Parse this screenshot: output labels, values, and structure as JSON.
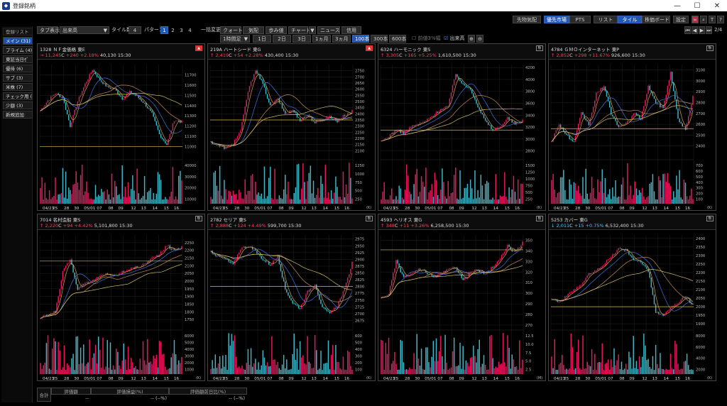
{
  "window": {
    "title": "登録銘柄",
    "minimize": "—",
    "maximize": "☐",
    "close": "✕"
  },
  "toolbar_top": {
    "pref_quote": "先物気配",
    "market": "優先市場",
    "pts": "PTS",
    "list": "リスト",
    "tile": "タイル",
    "board": "株価ボード",
    "settings": "設定",
    "page": "2/4"
  },
  "toolbar": {
    "tab_display": "タブ表示",
    "tab_select": "出来高",
    "tile_count_label": "タイル数",
    "tile_count": "4",
    "pattern_label": "パターン",
    "patterns": [
      "1",
      "2",
      "3",
      "4"
    ],
    "bulk_change": "一括変更",
    "quote": "クォート",
    "kehai": "気配",
    "bukai": "歩み値",
    "chart": "チャート",
    "news": "ニュース",
    "credit": "信用",
    "interval": "1時間足",
    "ranges": [
      "1日",
      "2日",
      "3日",
      "1ヵ月",
      "3ヵ月"
    ],
    "counts": [
      "100本",
      "300本",
      "600本"
    ],
    "opt1": "前値3%幅",
    "opt2": "出来高"
  },
  "sidebar": {
    "header": "登録リスト",
    "items": [
      "メイン (31)",
      "プライム (4)",
      "東証当日ｾﾞ",
      "優待 (6)",
      "サブ (3)",
      "米株 (7)",
      "チェック用 (",
      "少額 (3)",
      "新規追加"
    ]
  },
  "panels": [
    {
      "code": "1328",
      "name": "ＮＦ金価格",
      "market": "東E",
      "arrow": "→",
      "price": "11,245",
      "mark": "C",
      "change": "+240 +2.18%",
      "volume": "40,130",
      "time": "15:30",
      "dir": "up",
      "btn": "red",
      "chart_data": {
        "type": "candlestick",
        "ylim": [
          10900,
          11800
        ],
        "y_ticks": [
          "11700",
          "11600",
          "11500",
          "11400",
          "11300",
          "11200",
          "11100",
          "11000"
        ],
        "vol_ticks": [
          "40000",
          "30000",
          "20000",
          "10000"
        ],
        "vol_unit": "",
        "hline": 11000,
        "x_labels": [
          "04/23",
          "25",
          "28",
          "30",
          "05/01",
          "07",
          "08",
          "09",
          "12",
          "13",
          "14",
          "15",
          "16"
        ],
        "anchors": [
          11350,
          11450,
          11520,
          11480,
          11200,
          11440,
          11610,
          11750,
          11650,
          11580,
          11560,
          11470,
          11530,
          11490,
          11420,
          11320,
          11120,
          11020,
          11260,
          11240
        ]
      }
    },
    {
      "code": "219A",
      "name": "ハートシード",
      "market": "東G",
      "arrow": "↑",
      "price": "2,419",
      "mark": "C",
      "change": "+54 +2.28%",
      "volume": "430,400",
      "time": "15:30",
      "dir": "up",
      "btn": "red",
      "chart_data": {
        "type": "candlestick",
        "ylim": [
          2050,
          2800
        ],
        "y_ticks": [
          "2750",
          "2700",
          "2650",
          "2600",
          "2550",
          "2500",
          "2450",
          "2400",
          "2350",
          "2300",
          "2250",
          "2200",
          "2150",
          "2100"
        ],
        "vol_ticks": [
          "1250",
          "1000",
          "750",
          "500",
          "250"
        ],
        "vol_unit": "K",
        "hline": 2350,
        "x_labels": [
          "04/23",
          "25",
          "28",
          "30",
          "05/01",
          "07",
          "08",
          "09",
          "12",
          "13",
          "14",
          "15",
          "16"
        ],
        "anchors": [
          2170,
          2140,
          2120,
          2160,
          2260,
          2580,
          2760,
          2640,
          2460,
          2520,
          2400,
          2430,
          2350,
          2390,
          2330,
          2350,
          2380,
          2340,
          2390,
          2420
        ]
      }
    },
    {
      "code": "6324",
      "name": "ハーモニック",
      "market": "東S",
      "arrow": "↑",
      "price": "3,305",
      "mark": "C",
      "change": "+165 +5.25%",
      "volume": "1,610,500",
      "time": "15:30",
      "dir": "up",
      "btn": "",
      "chart_data": {
        "type": "candlestick",
        "ylim": [
          2700,
          4250
        ],
        "y_ticks": [
          "4200",
          "4000",
          "3800",
          "3600",
          "3400",
          "3200",
          "3000",
          "2800"
        ],
        "vol_ticks": [
          "1500",
          "1250",
          "1000",
          "750",
          "500",
          "250"
        ],
        "vol_unit": "K",
        "hline": 3150,
        "x_labels": [
          "04/23",
          "25",
          "28",
          "30",
          "05/01",
          "07",
          "08",
          "09",
          "12",
          "13",
          "14",
          "15",
          "16"
        ],
        "anchors": [
          2950,
          3050,
          3150,
          3100,
          3200,
          3250,
          3300,
          3400,
          3500,
          3550,
          4100,
          3900,
          3850,
          3550,
          3300,
          3150,
          3200,
          3350,
          3250,
          3305
        ]
      }
    },
    {
      "code": "4784",
      "name": "ＧＭＯインターネット",
      "market": "東P",
      "arrow": "↑",
      "price": "2,852",
      "mark": "C",
      "change": "+298 +11.67%",
      "volume": "926,600",
      "time": "15:30",
      "dir": "up",
      "btn": "",
      "chart_data": {
        "type": "candlestick",
        "ylim": [
          2300,
          3150
        ],
        "y_ticks": [
          "3100",
          "3000",
          "2900",
          "2800",
          "2700",
          "2600",
          "2500",
          "2400"
        ],
        "vol_ticks": [
          "700",
          "600",
          "500",
          "400",
          "300",
          "200",
          "100"
        ],
        "vol_unit": "K",
        "hline": 2560,
        "x_labels": [
          "04/23",
          "25",
          "28",
          "30",
          "05/01",
          "07",
          "08",
          "09",
          "12",
          "13",
          "14",
          "15",
          "16"
        ],
        "anchors": [
          2450,
          2600,
          2500,
          2430,
          2700,
          2600,
          2880,
          2950,
          2700,
          2580,
          2600,
          2700,
          2650,
          2950,
          2800,
          2750,
          3080,
          2650,
          2550,
          2852
        ]
      }
    },
    {
      "code": "7014",
      "name": "名村造船",
      "market": "東S",
      "arrow": "↑",
      "price": "2,220",
      "mark": "C",
      "change": "+94 +4.42%",
      "volume": "5,101,800",
      "time": "15:30",
      "dir": "up",
      "btn": "",
      "chart_data": {
        "type": "candlestick",
        "ylim": [
          1700,
          2300
        ],
        "y_ticks": [
          "2250",
          "2200",
          "2150",
          "2100",
          "2050",
          "2000",
          "1950",
          "1900",
          "1850",
          "1800",
          "1750"
        ],
        "vol_ticks": [
          "6000",
          "5000",
          "4000",
          "3000",
          "2000",
          "1000"
        ],
        "vol_unit": "K",
        "hline": 2130,
        "x_labels": [
          "04/23",
          "25",
          "28",
          "30",
          "05/01",
          "07",
          "08",
          "09",
          "12",
          "13",
          "14",
          "15",
          "16"
        ],
        "anchors": [
          1760,
          1780,
          1800,
          2060,
          2140,
          1950,
          1990,
          2000,
          2030,
          2050,
          2030,
          2060,
          2080,
          2090,
          2110,
          2150,
          2170,
          2230,
          2200,
          2220
        ]
      }
    },
    {
      "code": "2782",
      "name": "セリア",
      "market": "東S",
      "arrow": "↑",
      "price": "2,888",
      "mark": "C",
      "change": "+124 +4.49%",
      "volume": "599,700",
      "time": "15:30",
      "dir": "up",
      "btn": "",
      "chart_data": {
        "type": "candlestick",
        "ylim": [
          2650,
          2990
        ],
        "y_ticks": [
          "2975",
          "2950",
          "2925",
          "2900",
          "2875",
          "2850",
          "2825",
          "2800",
          "2775",
          "2750",
          "2725",
          "2700",
          "2675"
        ],
        "vol_ticks": [
          "600",
          "500",
          "400",
          "300",
          "200",
          "100"
        ],
        "vol_unit": "K",
        "hline": 2800,
        "x_labels": [
          "04/23",
          "25",
          "28",
          "30",
          "05/01",
          "07",
          "08",
          "09",
          "12",
          "13",
          "14",
          "15",
          "16"
        ],
        "anchors": [
          2930,
          2910,
          2900,
          2880,
          2940,
          2950,
          2930,
          2900,
          2880,
          2910,
          2790,
          2740,
          2720,
          2780,
          2810,
          2720,
          2700,
          2730,
          2790,
          2888
        ]
      }
    },
    {
      "code": "4593",
      "name": "ヘリオス",
      "market": "東G",
      "arrow": "↑",
      "price": "348",
      "mark": "C",
      "change": "+11 +3.26%",
      "volume": "6,258,500",
      "time": "15:30",
      "dir": "up",
      "btn": "",
      "chart_data": {
        "type": "candlestick",
        "ylim": [
          268,
          355
        ],
        "y_ticks": [
          "350",
          "340",
          "330",
          "320",
          "310",
          "300",
          "290",
          "280",
          "270"
        ],
        "vol_ticks": [
          "12.5",
          "10.0",
          "7.5",
          "5.0",
          "2.5"
        ],
        "vol_unit": "M",
        "hline": 341,
        "x_labels": [
          "04/23",
          "25",
          "28",
          "30",
          "05/01",
          "07",
          "08",
          "09",
          "12",
          "13",
          "14",
          "15",
          "16"
        ],
        "anchors": [
          295,
          300,
          330,
          315,
          318,
          322,
          320,
          315,
          318,
          322,
          325,
          312,
          320,
          322,
          318,
          325,
          332,
          345,
          338,
          348
        ]
      }
    },
    {
      "code": "5253",
      "name": "カバー",
      "market": "東G",
      "arrow": "↓",
      "price": "2,011",
      "mark": "C",
      "change": "+15 +0.75%",
      "volume": "6,532,400",
      "time": "15:30",
      "dir": "dn",
      "btn": "",
      "chart_data": {
        "type": "candlestick",
        "ylim": [
          1880,
          2420
        ],
        "y_ticks": [
          "2400",
          "2350",
          "2300",
          "2250",
          "2200",
          "2150",
          "2100",
          "2050",
          "2000",
          "1950",
          "1900"
        ],
        "vol_ticks": [
          "8000",
          "6000",
          "4000",
          "2000"
        ],
        "vol_unit": "K",
        "hline": 2000,
        "x_labels": [
          "04/23",
          "25",
          "28",
          "30",
          "05/01",
          "07",
          "08",
          "09",
          "12",
          "13",
          "14",
          "15",
          "16"
        ],
        "anchors": [
          2050,
          2030,
          2060,
          2100,
          2130,
          2190,
          2210,
          2250,
          2290,
          2340,
          2330,
          2280,
          2260,
          2210,
          1970,
          1950,
          1990,
          2020,
          2060,
          2011
        ]
      }
    }
  ],
  "footer": {
    "total": "合計",
    "eval_amount": "評価額",
    "eval_pl": "評価損益(%)",
    "eval_pl_prev": "評価額前日比(%)",
    "v1": "--",
    "v2": "-- (--%)",
    "v3": "-- (--%)"
  },
  "colors": {
    "up": "#ff3b5c",
    "down": "#33ccff",
    "vol_up": "#e8175d",
    "vol_down": "#3fb7c6",
    "ma1": "#d6a24a",
    "ma2": "#3d74e0",
    "ma3": "#c48a5a",
    "ma4": "#cfc060",
    "hline": "#d9b94a"
  }
}
